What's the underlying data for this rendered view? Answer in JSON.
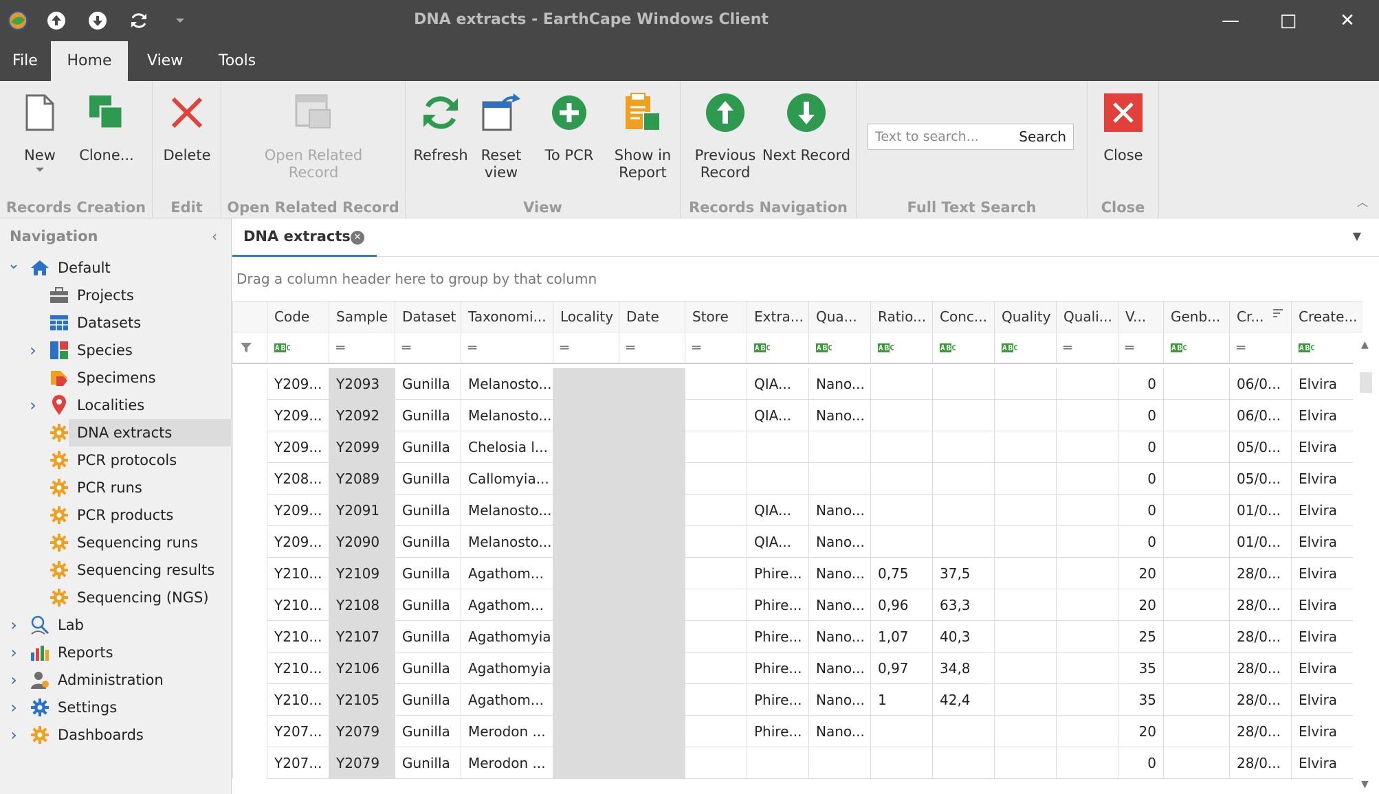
{
  "window": {
    "title": "DNA extracts - EarthCape Windows Client",
    "controls": [
      "—",
      "□",
      "✕"
    ]
  },
  "menu": {
    "tabs": [
      "File",
      "Home",
      "View",
      "Tools"
    ],
    "active": "Home"
  },
  "ribbon": {
    "groups": [
      {
        "label": "Records Creation",
        "buttons": [
          "New",
          "Clone..."
        ]
      },
      {
        "label": "Edit",
        "buttons": [
          "Delete"
        ]
      },
      {
        "label": "Open Related Record",
        "buttons": [
          "Open Related\nRecord"
        ]
      },
      {
        "label": "View",
        "buttons": [
          "Refresh",
          "Reset\nview",
          "To PCR",
          "Show in\nReport"
        ]
      },
      {
        "label": "Records Navigation",
        "buttons": [
          "Previous\nRecord",
          "Next Record"
        ]
      },
      {
        "label": "Full Text Search",
        "buttons": []
      },
      {
        "label": "Close",
        "buttons": [
          "Close"
        ]
      }
    ],
    "search": {
      "placeholder": "Text to search...",
      "button": "Search"
    }
  },
  "navigation": {
    "header": "Navigation",
    "items": [
      {
        "label": "Default",
        "level": 0,
        "expander": "open",
        "icon": "home-icon"
      },
      {
        "label": "Projects",
        "level": 1,
        "expander": "none",
        "icon": "briefcase-icon"
      },
      {
        "label": "Datasets",
        "level": 1,
        "expander": "none",
        "icon": "table-icon"
      },
      {
        "label": "Species",
        "level": 1,
        "expander": "closed",
        "icon": "species-icon"
      },
      {
        "label": "Specimens",
        "level": 1,
        "expander": "none",
        "icon": "tag-icon"
      },
      {
        "label": "Localities",
        "level": 1,
        "expander": "closed",
        "icon": "map-pin-icon"
      },
      {
        "label": "DNA extracts",
        "level": 1,
        "expander": "none",
        "icon": "gear-icon",
        "selected": true
      },
      {
        "label": "PCR protocols",
        "level": 1,
        "expander": "none",
        "icon": "gear-icon"
      },
      {
        "label": "PCR runs",
        "level": 1,
        "expander": "none",
        "icon": "gear-icon"
      },
      {
        "label": "PCR products",
        "level": 1,
        "expander": "none",
        "icon": "gear-icon"
      },
      {
        "label": "Sequencing runs",
        "level": 1,
        "expander": "none",
        "icon": "gear-icon"
      },
      {
        "label": "Sequencing results",
        "level": 1,
        "expander": "none",
        "icon": "gear-icon"
      },
      {
        "label": "Sequencing (NGS)",
        "level": 1,
        "expander": "none",
        "icon": "gear-icon"
      },
      {
        "label": "Lab",
        "level": 0,
        "expander": "closed",
        "icon": "lab-icon"
      },
      {
        "label": "Reports",
        "level": 0,
        "expander": "closed",
        "icon": "reports-icon"
      },
      {
        "label": "Administration",
        "level": 0,
        "expander": "closed",
        "icon": "user-icon"
      },
      {
        "label": "Settings",
        "level": 0,
        "expander": "closed",
        "icon": "settings-icon"
      },
      {
        "label": "Dashboards",
        "level": 0,
        "expander": "closed",
        "icon": "gear-icon"
      }
    ]
  },
  "document": {
    "tab": "DNA extracts"
  },
  "grid": {
    "group_panel": "Drag a column header here to group by that column",
    "columns": [
      {
        "key": "code",
        "label": "Code",
        "filter": "abc"
      },
      {
        "key": "sample",
        "label": "Sample",
        "filter": "eq"
      },
      {
        "key": "dataset",
        "label": "Dataset",
        "filter": "eq"
      },
      {
        "key": "taxon",
        "label": "Taxonomi...",
        "filter": "eq"
      },
      {
        "key": "locality",
        "label": "Locality",
        "filter": "eq"
      },
      {
        "key": "date",
        "label": "Date",
        "filter": "eq"
      },
      {
        "key": "store",
        "label": "Store",
        "filter": "eq"
      },
      {
        "key": "extra",
        "label": "Extra...",
        "filter": "abc"
      },
      {
        "key": "qua",
        "label": "Qua...",
        "filter": "abc"
      },
      {
        "key": "ratio",
        "label": "Ratio...",
        "filter": "abc"
      },
      {
        "key": "conc",
        "label": "Conc...",
        "filter": "abc"
      },
      {
        "key": "quality",
        "label": "Quality",
        "filter": "abc"
      },
      {
        "key": "quali",
        "label": "Quali...",
        "filter": "eq"
      },
      {
        "key": "v",
        "label": "V...",
        "filter": "eq"
      },
      {
        "key": "genb",
        "label": "Genb...",
        "filter": "abc"
      },
      {
        "key": "cr",
        "label": "Cr...",
        "filter": "eq"
      },
      {
        "key": "create",
        "label": "Create...",
        "filter": "abc"
      }
    ],
    "rows": [
      {
        "code": "Y209...",
        "sample": "Y2093",
        "dataset": "Gunilla",
        "taxon": "Melanosto...",
        "locality": "",
        "date": "",
        "store": "",
        "extra": "QIA...",
        "qua": "Nano...",
        "ratio": "",
        "conc": "",
        "quality": "",
        "quali": "",
        "v": "0",
        "genb": "",
        "cr": "06/0...",
        "create": "Elvira"
      },
      {
        "code": "Y209...",
        "sample": "Y2092",
        "dataset": "Gunilla",
        "taxon": "Melanosto...",
        "locality": "",
        "date": "",
        "store": "",
        "extra": "QIA...",
        "qua": "Nano...",
        "ratio": "",
        "conc": "",
        "quality": "",
        "quali": "",
        "v": "0",
        "genb": "",
        "cr": "06/0...",
        "create": "Elvira"
      },
      {
        "code": "Y209...",
        "sample": "Y2099",
        "dataset": "Gunilla",
        "taxon": "Chelosia l...",
        "locality": "",
        "date": "",
        "store": "",
        "extra": "",
        "qua": "",
        "ratio": "",
        "conc": "",
        "quality": "",
        "quali": "",
        "v": "0",
        "genb": "",
        "cr": "05/0...",
        "create": "Elvira"
      },
      {
        "code": "Y208...",
        "sample": "Y2089",
        "dataset": "Gunilla",
        "taxon": "Callomyia...",
        "locality": "",
        "date": "",
        "store": "",
        "extra": "",
        "qua": "",
        "ratio": "",
        "conc": "",
        "quality": "",
        "quali": "",
        "v": "0",
        "genb": "",
        "cr": "05/0...",
        "create": "Elvira"
      },
      {
        "code": "Y209...",
        "sample": "Y2091",
        "dataset": "Gunilla",
        "taxon": "Melanosto...",
        "locality": "",
        "date": "",
        "store": "",
        "extra": "QIA...",
        "qua": "Nano...",
        "ratio": "",
        "conc": "",
        "quality": "",
        "quali": "",
        "v": "0",
        "genb": "",
        "cr": "01/0...",
        "create": "Elvira"
      },
      {
        "code": "Y209...",
        "sample": "Y2090",
        "dataset": "Gunilla",
        "taxon": "Melanosto...",
        "locality": "",
        "date": "",
        "store": "",
        "extra": "QIA...",
        "qua": "Nano...",
        "ratio": "",
        "conc": "",
        "quality": "",
        "quali": "",
        "v": "0",
        "genb": "",
        "cr": "01/0...",
        "create": "Elvira"
      },
      {
        "code": "Y210...",
        "sample": "Y2109",
        "dataset": "Gunilla",
        "taxon": "Agathom...",
        "locality": "",
        "date": "",
        "store": "",
        "extra": "Phire...",
        "qua": "Nano...",
        "ratio": "0,75",
        "conc": "37,5",
        "quality": "",
        "quali": "",
        "v": "20",
        "genb": "",
        "cr": "28/0...",
        "create": "Elvira"
      },
      {
        "code": "Y210...",
        "sample": "Y2108",
        "dataset": "Gunilla",
        "taxon": "Agathom...",
        "locality": "",
        "date": "",
        "store": "",
        "extra": "Phire...",
        "qua": "Nano...",
        "ratio": "0,96",
        "conc": "63,3",
        "quality": "",
        "quali": "",
        "v": "20",
        "genb": "",
        "cr": "28/0...",
        "create": "Elvira"
      },
      {
        "code": "Y210...",
        "sample": "Y2107",
        "dataset": "Gunilla",
        "taxon": "Agathomyia",
        "locality": "",
        "date": "",
        "store": "",
        "extra": "Phire...",
        "qua": "Nano...",
        "ratio": "1,07",
        "conc": "40,3",
        "quality": "",
        "quali": "",
        "v": "25",
        "genb": "",
        "cr": "28/0...",
        "create": "Elvira"
      },
      {
        "code": "Y210...",
        "sample": "Y2106",
        "dataset": "Gunilla",
        "taxon": "Agathomyia",
        "locality": "",
        "date": "",
        "store": "",
        "extra": "Phire...",
        "qua": "Nano...",
        "ratio": "0,97",
        "conc": "34,8",
        "quality": "",
        "quali": "",
        "v": "35",
        "genb": "",
        "cr": "28/0...",
        "create": "Elvira"
      },
      {
        "code": "Y210...",
        "sample": "Y2105",
        "dataset": "Gunilla",
        "taxon": "Agathom...",
        "locality": "",
        "date": "",
        "store": "",
        "extra": "Phire...",
        "qua": "Nano...",
        "ratio": "1",
        "conc": "42,4",
        "quality": "",
        "quali": "",
        "v": "35",
        "genb": "",
        "cr": "28/0...",
        "create": "Elvira"
      },
      {
        "code": "Y207...",
        "sample": "Y2079",
        "dataset": "Gunilla",
        "taxon": "Merodon ...",
        "locality": "",
        "date": "",
        "store": "",
        "extra": "Phire...",
        "qua": "Nano...",
        "ratio": "",
        "conc": "",
        "quality": "",
        "quali": "",
        "v": "20",
        "genb": "",
        "cr": "28/0...",
        "create": "Elvira"
      },
      {
        "code": "Y207...",
        "sample": "Y2079",
        "dataset": "Gunilla",
        "taxon": "Merodon ...",
        "locality": "",
        "date": "",
        "store": "",
        "extra": "",
        "qua": "",
        "ratio": "",
        "conc": "",
        "quality": "",
        "quali": "",
        "v": "0",
        "genb": "",
        "cr": "28/0...",
        "create": "Elvira"
      }
    ]
  },
  "colors": {
    "titlebar": "#474747",
    "ribbon": "#ececec",
    "accent_blue": "#3a78c2",
    "green": "#2e9a50",
    "red": "#e0413a",
    "orange": "#f0a020"
  }
}
